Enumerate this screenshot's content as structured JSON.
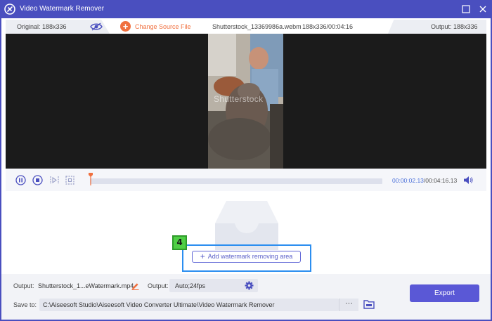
{
  "window": {
    "title": "Video Watermark Remover",
    "icons": {
      "app": "app-logo-icon",
      "maximize": "maximize-icon",
      "close": "close-icon"
    }
  },
  "infobar": {
    "original_label": "Original: 188x336",
    "change_source_label": "Change Source File",
    "file_name": "Shutterstock_13369986a.webm",
    "file_meta": "188x336/00:04:16",
    "output_label": "Output: 188x336"
  },
  "preview": {
    "watermark_text": "Shutterstock"
  },
  "playback": {
    "current_time": "00:00:02.13",
    "total_time": "/00:04:16.13",
    "progress": 0.008
  },
  "workspace": {
    "step_number": "4",
    "add_area_label": "Add watermark removing area"
  },
  "bottom": {
    "output_label": "Output:",
    "output_file": "Shutterstock_1...eWatermark.mp4",
    "format_label": "Output:",
    "format_value": "Auto;24fps",
    "save_label": "Save to:",
    "save_path": "C:\\Aiseesoft Studio\\Aiseesoft Video Converter Ultimate\\Video Watermark Remover",
    "browse_label": "···",
    "export_label": "Export"
  },
  "colors": {
    "accent": "#4a4fbf",
    "orange": "#f0703f",
    "export": "#5a58d6",
    "highlight": "#2b8ef0",
    "badge": "#4fcf45"
  }
}
